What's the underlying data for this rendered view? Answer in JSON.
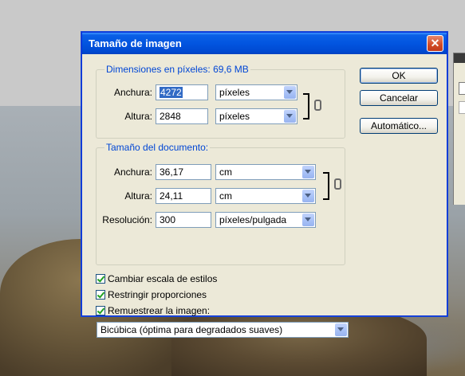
{
  "dialog": {
    "title": "Tamaño de imagen",
    "close_glyph": "✕"
  },
  "pixel_dimensions": {
    "legend": "Dimensiones en píxeles: 69,6 MB",
    "width_label": "Anchura:",
    "width_value": "4272",
    "width_unit": "píxeles",
    "height_label": "Altura:",
    "height_value": "2848",
    "height_unit": "píxeles"
  },
  "document_size": {
    "legend": "Tamaño del documento:",
    "width_label": "Anchura:",
    "width_value": "36,17",
    "width_unit": "cm",
    "height_label": "Altura:",
    "height_value": "24,11",
    "height_unit": "cm",
    "resolution_label": "Resolución:",
    "resolution_value": "300",
    "resolution_unit": "píxeles/pulgada"
  },
  "buttons": {
    "ok": "OK",
    "cancel": "Cancelar",
    "auto": "Automático..."
  },
  "options": {
    "scale_styles": "Cambiar escala de estilos",
    "constrain": "Restringir proporciones",
    "resample": "Remuestrear la imagen:",
    "resample_method": "Bicúbica (óptima para degradados suaves)"
  },
  "icons": {
    "link": "chain-link-icon",
    "dropdown": "chevron-down-icon",
    "check": "checkmark-icon"
  },
  "colors": {
    "titlebar": "#0255e0",
    "legend": "#0046d5",
    "selection": "#316ac5",
    "check": "#21a121"
  }
}
